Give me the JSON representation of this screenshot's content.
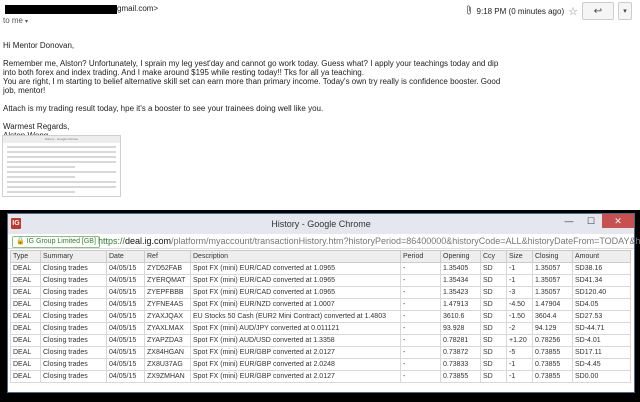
{
  "email": {
    "sender_domain": "gmail.com>",
    "to_line": "to me",
    "to_caret": "▾",
    "clip_icon": "paperclip-icon",
    "timestamp": "9:18 PM (0 minutes ago)",
    "star": "☆",
    "reply_glyph": "↩",
    "more_glyph": "▾",
    "greeting": "Hi Mentor Donovan,",
    "body_lines": [
      "Remember me, Alston? Unfortunately, I sprain my leg yest'day and cannot go work today. Guess what? I apply your teachings today and dip",
      "into both forex and index trading. And I make around $195 while resting today!! Tks for all ya teaching.",
      "You are right, I m starting to belief alternative skill set can earn more than primary income. Today's own try really is confidence booster. Good",
      "job, mentor!"
    ],
    "attach_line": "Attach is my trading result today, hpe it's a booster to see your trainees doing well like you.",
    "closing": "Warmest Regards,",
    "signature": "Alston Wong",
    "thumbnail_title": "History - Google Chrome"
  },
  "window": {
    "title": "History - Google Chrome",
    "icon_text": "IG",
    "controls": {
      "minimize": "—",
      "maximize": "☐",
      "close": "✕"
    },
    "secure_label": "IG Group Limited [GB]",
    "url_scheme": "https://",
    "url_host": "deal.ig.com",
    "url_path": "/platform/myaccount/transactionHistory.htm?historyPeriod=86400000&historyCode=ALL&historyDateFrom=TODAY&his"
  },
  "table": {
    "headers": [
      "Type",
      "Summary",
      "Date",
      "Ref",
      "Description",
      "Period",
      "Opening",
      "Ccy",
      "Size",
      "Closing",
      "Amount"
    ],
    "rows": [
      [
        "DEAL",
        "Closing trades",
        "04/05/15",
        "ZYD52FAB",
        "Spot FX (mini) EUR/CAD converted at 1.0965",
        "-",
        "1.35405",
        "SD",
        "-1",
        "1.35057",
        "SD38.16"
      ],
      [
        "DEAL",
        "Closing trades",
        "04/05/15",
        "ZYERQMAT",
        "Spot FX (mini) EUR/CAD converted at 1.0965",
        "-",
        "1.35434",
        "SD",
        "-1",
        "1.35057",
        "SD41.34"
      ],
      [
        "DEAL",
        "Closing trades",
        "04/05/15",
        "ZYEPFBBB",
        "Spot FX (mini) EUR/CAD converted at 1.0965",
        "-",
        "1.35423",
        "SD",
        "-3",
        "1.35057",
        "SD120.40"
      ],
      [
        "DEAL",
        "Closing trades",
        "04/05/15",
        "ZYFNE4AS",
        "Spot FX (mini) EUR/NZD converted at 1.0007",
        "-",
        "1.47913",
        "SD",
        "-4.50",
        "1.47904",
        "SD4.05"
      ],
      [
        "DEAL",
        "Closing trades",
        "04/05/15",
        "ZYAXJQAX",
        "EU Stocks 50 Cash (EUR2 Mini Contract) converted at 1.4803",
        "-",
        "3610.6",
        "SD",
        "-1.50",
        "3604.4",
        "SD27.53"
      ],
      [
        "DEAL",
        "Closing trades",
        "04/05/15",
        "ZYAXLMAX",
        "Spot FX (mini) AUD/JPY converted at 0.011121",
        "-",
        "93.928",
        "SD",
        "-2",
        "94.129",
        "SD-44.71"
      ],
      [
        "DEAL",
        "Closing trades",
        "04/05/15",
        "ZYAPZDA3",
        "Spot FX (mini) AUD/USD converted at 1.3358",
        "-",
        "0.78281",
        "SD",
        "+1.20",
        "0.78256",
        "SD-4.01"
      ],
      [
        "DEAL",
        "Closing trades",
        "04/05/15",
        "ZX84HGAN",
        "Spot FX (mini) EUR/GBP converted at 2.0127",
        "-",
        "0.73872",
        "SD",
        "-5",
        "0.73855",
        "SD17.11"
      ],
      [
        "DEAL",
        "Closing trades",
        "04/05/15",
        "ZX8U37AG",
        "Spot FX (mini) EUR/GBP converted at 2.0248",
        "-",
        "0.73833",
        "SD",
        "-1",
        "0.73855",
        "SD-4.45"
      ],
      [
        "DEAL",
        "Closing trades",
        "04/05/15",
        "ZX9ZMHAN",
        "Spot FX (mini) EUR/GBP converted at 2.0127",
        "-",
        "0.73855",
        "SD",
        "-1",
        "0.73855",
        "SD0.00"
      ]
    ]
  }
}
